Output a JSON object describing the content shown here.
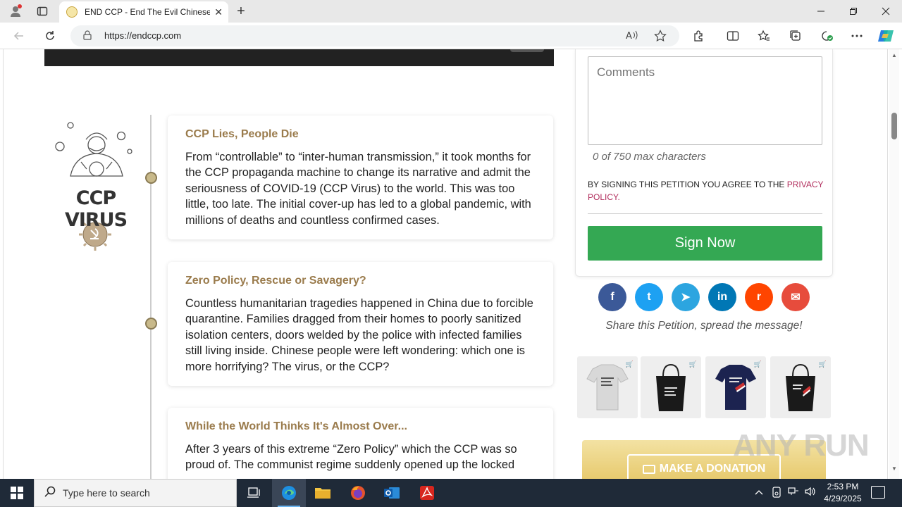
{
  "browser": {
    "tab_title": "END CCP - End The Evil Chinese",
    "url": "https://endccp.com",
    "new_tab_symbol": "+",
    "close_symbol": "✕"
  },
  "timeline": {
    "logo_title": "CCP VIRUS",
    "cards": [
      {
        "title": "CCP Lies, People Die",
        "body": "From “controllable” to “inter-human transmission,” it took months for the CCP propaganda machine to change its narrative and admit the seriousness of COVID-19 (CCP Virus) to the world. This was too little, too late. The initial cover-up has led to a global pandemic, with millions of deaths and countless confirmed cases."
      },
      {
        "title": "Zero Policy, Rescue or Savagery?",
        "body": "Countless humanitarian tragedies happened in China due to forcible quarantine. Families dragged from their homes to poorly sanitized isolation centers, doors welded by the police with infected families still living inside. Chinese people were left wondering: which one is more horrifying? The virus, or the CCP?"
      },
      {
        "title": "While the World Thinks It's Almost Over...",
        "body": "After 3 years of this extreme “Zero Policy” which the CCP was so proud of. The communist regime suddenly opened up the locked"
      }
    ]
  },
  "petition": {
    "comments_placeholder": "Comments",
    "char_count": "0 of 750 max characters",
    "agree_text": "BY SIGNING THIS PETITION YOU AGREE TO THE ",
    "privacy_link": "PRIVACY POLICY.",
    "sign_label": "Sign Now",
    "share_caption": "Share this Petition, spread the message!",
    "share_buttons": [
      {
        "name": "facebook",
        "glyph": "f",
        "color": "#3b5998"
      },
      {
        "name": "twitter",
        "glyph": "t",
        "color": "#1da1f2"
      },
      {
        "name": "telegram",
        "glyph": "➤",
        "color": "#2ca5e0"
      },
      {
        "name": "linkedin",
        "glyph": "in",
        "color": "#0077b5"
      },
      {
        "name": "reddit",
        "glyph": "r",
        "color": "#ff4500"
      },
      {
        "name": "email",
        "glyph": "✉",
        "color": "#e74c3c"
      }
    ]
  },
  "donation": {
    "label": "MAKE A DONATION"
  },
  "watermark": "ANY RUN",
  "taskbar": {
    "search_placeholder": "Type here to search",
    "time": "2:53 PM",
    "date": "4/29/2025"
  }
}
